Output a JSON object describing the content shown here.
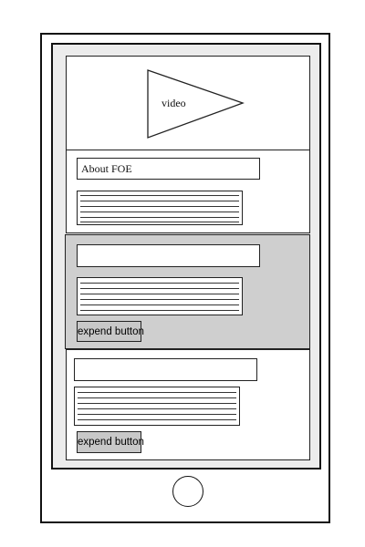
{
  "video": {
    "label": "video"
  },
  "about": {
    "title": "About FOE"
  },
  "sections": [
    {
      "title": "",
      "button_label": "expend button"
    },
    {
      "title": "",
      "button_label": "expend button"
    }
  ],
  "colors": {
    "expanded_section_bg": "#cfcfcf",
    "button_bg": "#c8c8c8"
  },
  "icons": {
    "video_player": "play-triangle-icon",
    "home": "home-button-circle"
  }
}
